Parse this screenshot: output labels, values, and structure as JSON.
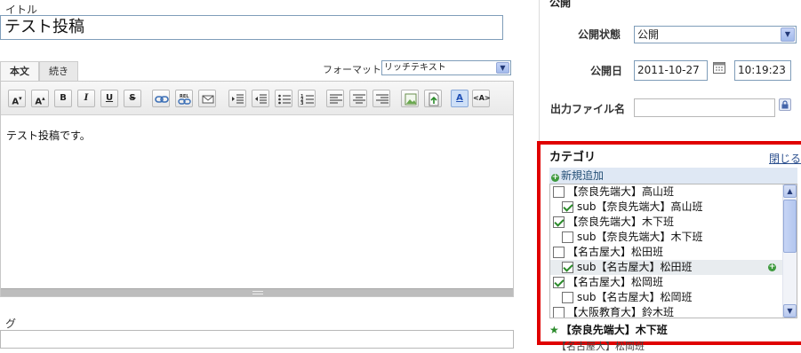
{
  "editor": {
    "title_label": "イトル",
    "title_value": "テスト投稿",
    "tabs": [
      {
        "label": "本文"
      },
      {
        "label": "続き"
      }
    ],
    "format_label": "フォーマット:",
    "format_value": "リッチテキスト",
    "toolbar": {
      "font_shrink": "A",
      "font_grow": "A",
      "bold": "B",
      "italic": "I",
      "underline": "U",
      "strike": "S",
      "textcolor": "A",
      "html": "<A>"
    },
    "content": "テスト投稿です。",
    "tag_label": "グ"
  },
  "publish": {
    "heading": "公開",
    "status_label": "公開状態",
    "status_value": "公開",
    "date_label": "公開日",
    "date_value": "2011-10-27",
    "time_value": "10:19:23",
    "filename_label": "出力ファイル名",
    "filename_value": ""
  },
  "category": {
    "title": "カテゴリ",
    "close_label": "閉じる",
    "new_label": "新規追加",
    "items": [
      {
        "label": "【奈良先端大】高山班",
        "checked": false,
        "level": 0
      },
      {
        "label": "sub【奈良先端大】高山班",
        "checked": true,
        "level": 1
      },
      {
        "label": "【奈良先端大】木下班",
        "checked": true,
        "level": 0
      },
      {
        "label": "sub【奈良先端大】木下班",
        "checked": false,
        "level": 1
      },
      {
        "label": "【名古屋大】松田班",
        "checked": false,
        "level": 0
      },
      {
        "label": "sub【名古屋大】松田班",
        "checked": true,
        "level": 1
      },
      {
        "label": "【名古屋大】松岡班",
        "checked": true,
        "level": 0
      },
      {
        "label": "sub【名古屋大】松岡班",
        "checked": false,
        "level": 1
      },
      {
        "label": "【大阪教育大】鈴木班",
        "checked": false,
        "level": 0
      }
    ],
    "primary": "【奈良先端大】木下班",
    "below_partial": "【名古屋大】松岡班"
  }
}
